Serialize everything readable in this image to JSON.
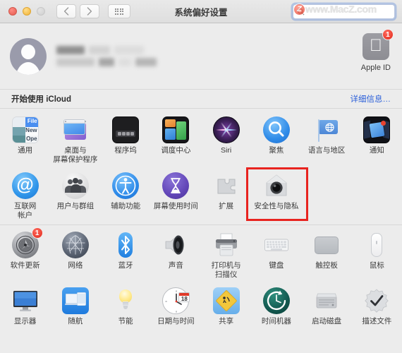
{
  "window": {
    "title": "系统偏好设置",
    "traffic_lights": [
      {
        "name": "close",
        "color": "#ec6a5f",
        "glyph": "×"
      },
      {
        "name": "minimize",
        "color": "#f5bf4f",
        "glyph": "−"
      },
      {
        "name": "zoom",
        "color": "#d5d5d5",
        "glyph": ""
      }
    ],
    "toolbar": {
      "back_label": "‹",
      "forward_label": "›",
      "show_all_label": "show-all-grid"
    },
    "search": {
      "value": "",
      "placeholder": "",
      "icon": "search-icon"
    },
    "watermark": {
      "badge": "Z",
      "text": "www.MacZ.com"
    }
  },
  "account": {
    "name_redacted": true,
    "avatar_icon": "user-avatar-icon",
    "apple_id": {
      "label": "Apple ID",
      "badge_count": "1",
      "icon": "apple-logo-icon"
    }
  },
  "icloud_bar": {
    "title": "开始使用 iCloud",
    "details_link": "详细信息…",
    "link_color": "#2b5fd9"
  },
  "highlight": {
    "target": "安全性与隐私",
    "color": "#e8231f"
  },
  "sections": [
    {
      "name": "personal",
      "rows": [
        [
          {
            "label": "通用",
            "icon": "general-icon"
          },
          {
            "label": "桌面与\n屏幕保护程序",
            "icon": "desktop-screensaver-icon"
          },
          {
            "label": "程序坞",
            "icon": "dock-icon"
          },
          {
            "label": "调度中心",
            "icon": "mission-control-icon"
          },
          {
            "label": "Siri",
            "icon": "siri-icon"
          },
          {
            "label": "聚焦",
            "icon": "spotlight-icon"
          },
          {
            "label": "语言与地区",
            "icon": "language-region-icon"
          },
          {
            "label": "通知",
            "icon": "notifications-icon"
          }
        ],
        [
          {
            "label": "互联网\n帐户",
            "icon": "internet-accounts-icon"
          },
          {
            "label": "用户与群组",
            "icon": "users-groups-icon"
          },
          {
            "label": "辅助功能",
            "icon": "accessibility-icon"
          },
          {
            "label": "屏幕使用时间",
            "icon": "screen-time-icon"
          },
          {
            "label": "扩展",
            "icon": "extensions-icon"
          },
          {
            "label": "安全性与隐私",
            "icon": "security-privacy-icon"
          },
          {
            "label": "",
            "icon": ""
          },
          {
            "label": "",
            "icon": ""
          }
        ]
      ]
    },
    {
      "name": "hardware",
      "rows": [
        [
          {
            "label": "软件更新",
            "icon": "software-update-icon",
            "badge": "1"
          },
          {
            "label": "网络",
            "icon": "network-icon"
          },
          {
            "label": "蓝牙",
            "icon": "bluetooth-icon"
          },
          {
            "label": "声音",
            "icon": "sound-icon"
          },
          {
            "label": "打印机与\n扫描仪",
            "icon": "printers-scanners-icon"
          },
          {
            "label": "键盘",
            "icon": "keyboard-icon"
          },
          {
            "label": "触控板",
            "icon": "trackpad-icon"
          },
          {
            "label": "鼠标",
            "icon": "mouse-icon"
          }
        ],
        [
          {
            "label": "显示器",
            "icon": "displays-icon"
          },
          {
            "label": "随航",
            "icon": "sidecar-icon"
          },
          {
            "label": "节能",
            "icon": "energy-saver-icon"
          },
          {
            "label": "日期与时间",
            "icon": "date-time-icon",
            "day": "18"
          },
          {
            "label": "共享",
            "icon": "sharing-icon"
          },
          {
            "label": "时间机器",
            "icon": "time-machine-icon"
          },
          {
            "label": "启动磁盘",
            "icon": "startup-disk-icon"
          },
          {
            "label": "描述文件",
            "icon": "profiles-icon"
          }
        ]
      ]
    }
  ]
}
